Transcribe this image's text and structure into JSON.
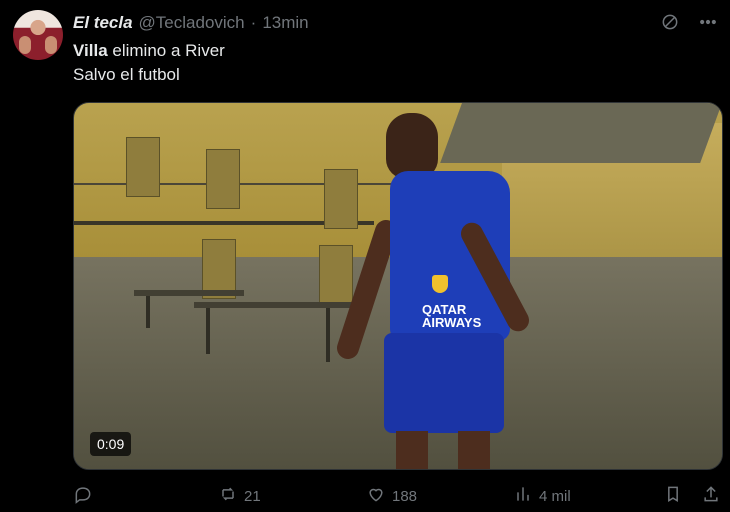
{
  "post": {
    "author_name": "El tecla",
    "author_handle": "@Tecladovich",
    "separator": "·",
    "time_ago": "13min",
    "text_bold": "Villa",
    "text_line1_rest": " elimino a River",
    "text_line2": "Salvo el futbol",
    "video_time": "0:09",
    "jersey_text": "QATAR AIRWAYS"
  },
  "actions": {
    "retweets": "21",
    "likes": "188",
    "views": "4 mil"
  },
  "icons": {
    "top": [
      "grok-icon",
      "more-icon"
    ],
    "bottom": [
      "reply-icon",
      "retweet-icon",
      "like-icon",
      "views-icon",
      "bookmark-icon",
      "share-icon"
    ]
  }
}
